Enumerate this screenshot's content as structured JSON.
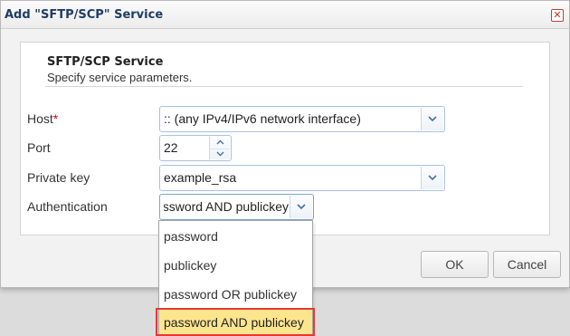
{
  "dialog": {
    "title": "Add \"SFTP/SCP\" Service",
    "close_icon": "close-icon",
    "section_title": "SFTP/SCP Service",
    "section_subtitle": "Specify service parameters."
  },
  "form": {
    "host": {
      "label": "Host",
      "required_mark": "*",
      "value": ":: (any IPv4/IPv6 network interface)"
    },
    "port": {
      "label": "Port",
      "value": "22"
    },
    "private_key": {
      "label": "Private key",
      "value": "example_rsa"
    },
    "authentication": {
      "label": "Authentication",
      "value": "password AND publickey",
      "options": [
        "password",
        "publickey",
        "password OR publickey",
        "password AND publickey"
      ],
      "selected_index": 3
    }
  },
  "buttons": {
    "ok": "OK",
    "cancel": "Cancel"
  },
  "colors": {
    "title": "#1f3d64",
    "required": "#d0021b",
    "selected_option": "#fde58e",
    "highlight_border": "#e53935",
    "field_border": "#a9c2e0"
  },
  "icons": {
    "dropdown": "chevron-down-icon",
    "spin_up": "chevron-up-icon",
    "spin_down": "chevron-down-icon"
  }
}
